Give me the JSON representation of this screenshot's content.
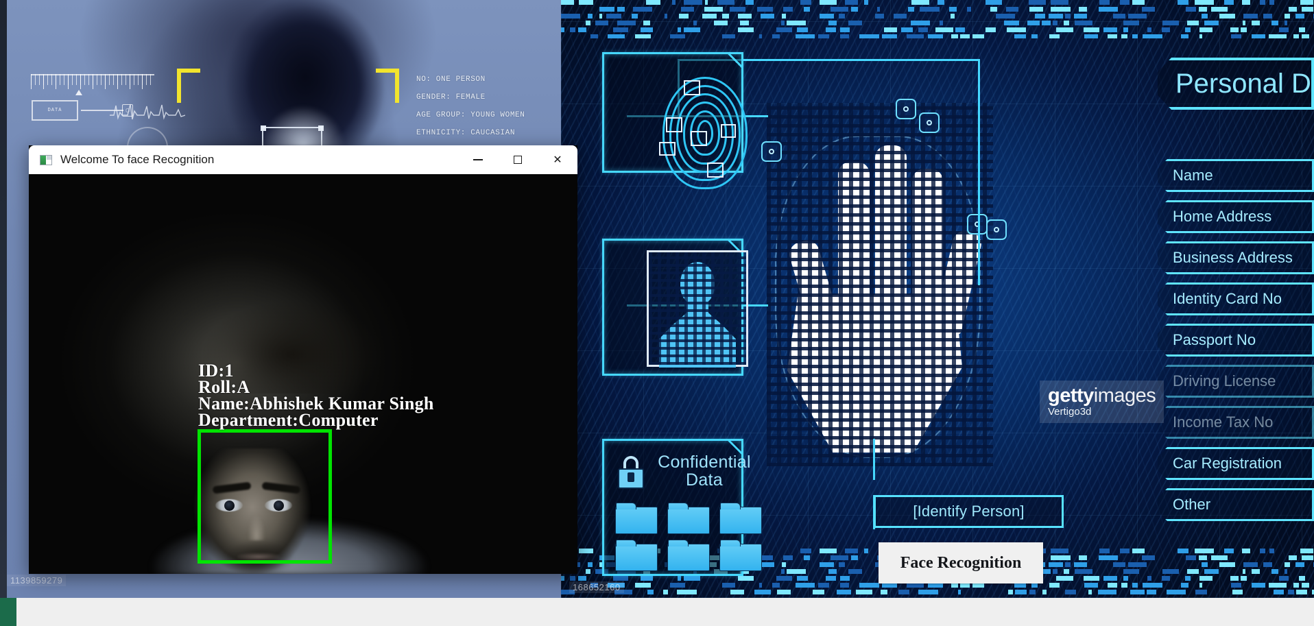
{
  "window": {
    "title": "Welcome To face Recognition",
    "icon": "app-icon",
    "controls": {
      "minimize": "—",
      "maximize": "□",
      "close": "✕"
    }
  },
  "video_overlay": {
    "lines": [
      "ID:1",
      "Roll:A",
      "Name:Abhishek Kumar Singh",
      "Department:Computer"
    ],
    "detection_box_color": "#00e400"
  },
  "wallpaper_left": {
    "hud_label": "DATA",
    "hud_box_value": "▢",
    "biometric_readout": [
      "NO: ONE PERSON",
      "GENDER: FEMALE",
      "AGE GROUP: YOUNG WOMEN",
      "ETHNICITY: CAUCASIAN"
    ],
    "watermark_id": "1139859279"
  },
  "wallpaper_right": {
    "panel_title": "Personal D",
    "fields": [
      {
        "label": "Name",
        "dim": false
      },
      {
        "label": "Home Address",
        "dim": false
      },
      {
        "label": "Business Address",
        "dim": false
      },
      {
        "label": "Identity Card No",
        "dim": false
      },
      {
        "label": "Passport No",
        "dim": false
      },
      {
        "label": "Driving License",
        "dim": true
      },
      {
        "label": "Income Tax No",
        "dim": true
      },
      {
        "label": "Car Registration",
        "dim": false
      },
      {
        "label": "Other",
        "dim": false
      }
    ],
    "confidential": {
      "title_line1": "Confidential",
      "title_line2": "Data",
      "folder_count": 6
    },
    "identify_button": "[Identify Person]",
    "caption_plate": "Face Recognition",
    "watermark_id": "168652160",
    "getty": {
      "bold": "getty",
      "light": "images",
      "artist": "Vertigo3d"
    },
    "accent_color": "#46d8ff"
  }
}
